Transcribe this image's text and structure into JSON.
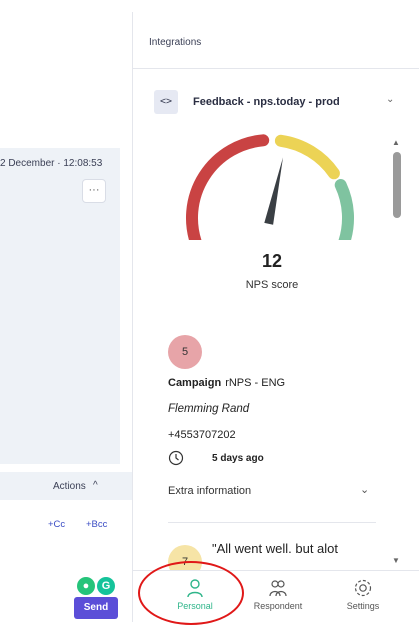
{
  "left_panel": {
    "timestamp": "2 December · 12:08:53",
    "more_label": "···",
    "actions_label": "Actions",
    "actions_caret": "^",
    "cc_label": "+Cc",
    "bcc_label": "+Bcc",
    "send_label": "Send"
  },
  "integrations_header": "Integrations",
  "widget": {
    "code_icon_text": "<>",
    "title": "Feedback - nps.today - prod",
    "chevron": "⌄",
    "nps_score": "12",
    "nps_label": "NPS score",
    "gauge_fraction": 0.56
  },
  "response": {
    "score": "5",
    "campaign_label": "Campaign",
    "campaign_value": "rNPS - ENG",
    "name": "Flemming Rand",
    "phone": "+4553707202",
    "time_ago": "5 days ago",
    "extra_info_label": "Extra information",
    "extra_chevron": "⌄"
  },
  "next_response": {
    "score": "7",
    "quote": "\"All went well. but alot"
  },
  "nav": {
    "personal": "Personal",
    "respondent": "Respondent",
    "settings": "Settings"
  },
  "colors": {
    "gauge_red": "#c94343",
    "gauge_yellow": "#ecd355",
    "gauge_green": "#7fc3a0",
    "accent_green": "#2fb58a",
    "send_purple": "#5b4ed8",
    "highlight_red": "#e01818"
  }
}
